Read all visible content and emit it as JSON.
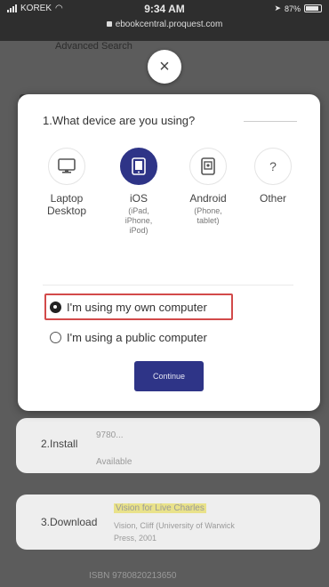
{
  "status_bar": {
    "carrier": "KOREK",
    "time": "9:34 AM",
    "battery": "87%",
    "url": "ebookcentral.proquest.com"
  },
  "background": {
    "search_link": "Advanced Search",
    "install_label": "2.Install",
    "install_faded_1": "9780...",
    "install_faded_2": "Available",
    "download_label": "3.Download",
    "download_faded_1": "Vision for Live Charles",
    "download_faded_2": "Vision, Cliff (University of Warwick",
    "download_faded_3": "Press, 2001",
    "download_faded_4": "ISBN 9780820213650"
  },
  "modal": {
    "close_symbol": "×",
    "title": "1.What device are you using?",
    "devices": [
      {
        "label": "Laptop",
        "label2": "Desktop",
        "sub": [],
        "icon": "monitor-icon",
        "selected": false
      },
      {
        "label": "iOS",
        "label2": "",
        "sub": [
          "(iPad,",
          "iPhone,",
          "iPod)"
        ],
        "icon": "tablet-icon",
        "selected": true
      },
      {
        "label": "Android",
        "label2": "",
        "sub": [
          "(Phone,",
          "tablet)"
        ],
        "icon": "android-device-icon",
        "selected": false
      },
      {
        "label": "Other",
        "label2": "",
        "sub": [],
        "icon": "question-icon",
        "selected": false
      }
    ],
    "other_symbol": "?",
    "radio_own": "I'm using my own computer",
    "radio_public": "I'm using a public computer",
    "continue_label": "Continue"
  },
  "colors": {
    "accent": "#2e3487",
    "highlight_border": "#d24a4a"
  }
}
